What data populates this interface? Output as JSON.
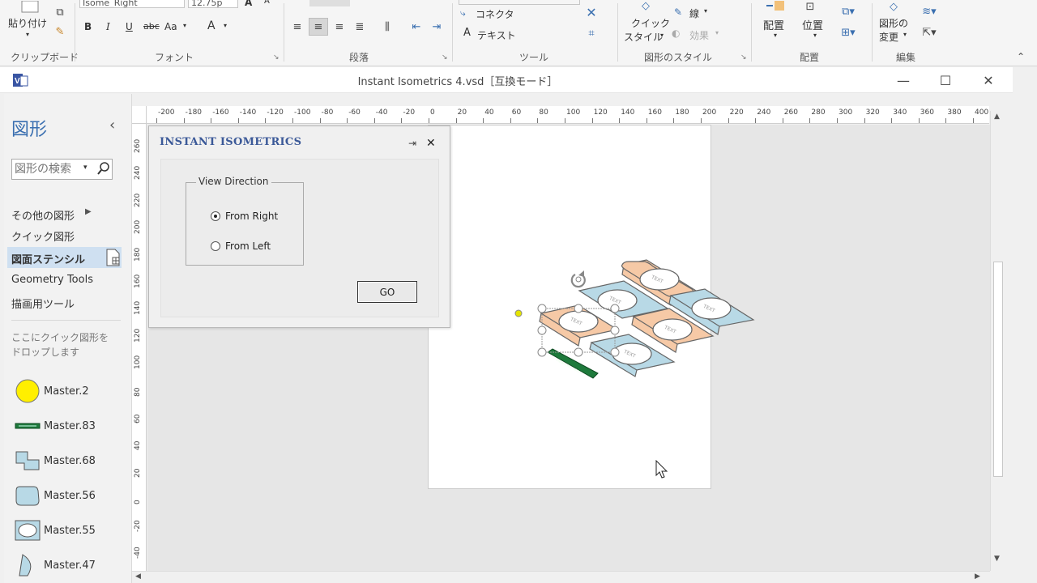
{
  "ribbon": {
    "clipboard": {
      "paste": "貼り付け",
      "group": "クリップボード"
    },
    "font": {
      "name": "Isome_Right",
      "size": "12.75p",
      "bold": "B",
      "italic": "I",
      "underline": "U",
      "strike": "abc",
      "case": "Aa",
      "color": "A",
      "group": "フォント"
    },
    "paragraph": {
      "group": "段落"
    },
    "tools": {
      "connector": "コネクタ",
      "text": "テキスト",
      "group": "ツール"
    },
    "shape_style": {
      "quick": "クイック",
      "style": "スタイル",
      "line": "線",
      "effect": "効果",
      "group": "図形のスタイル"
    },
    "arrange": {
      "align": "配置",
      "position": "位置",
      "group": "配置"
    },
    "edit": {
      "change1": "図形の",
      "change2": "変更",
      "group": "編集"
    }
  },
  "window": {
    "title": "Instant Isometrics 4.vsd［互換モード］",
    "min": "—",
    "max": "☐",
    "close": "✕"
  },
  "shapes_pane": {
    "title": "図形",
    "collapse": "‹",
    "search_placeholder": "図形の検索",
    "more": "その他の図形",
    "quick": "クイック図形",
    "stencil": "図面ステンシル",
    "geometry": "Geometry Tools",
    "drawing": "描画用ツール",
    "hint": "ここにクイック図形をドロップします",
    "masters": [
      "Master.2",
      "Master.83",
      "Master.68",
      "Master.56",
      "Master.55",
      "Master.47"
    ]
  },
  "hruler": [
    "-200",
    "-180",
    "-160",
    "-140",
    "-120",
    "-100",
    "-80",
    "-60",
    "-40",
    "-20",
    "0",
    "20",
    "40",
    "60",
    "80",
    "100",
    "120",
    "140",
    "160",
    "180",
    "200",
    "220",
    "240",
    "260",
    "280",
    "300",
    "320",
    "340",
    "360",
    "380",
    "400"
  ],
  "vruler": [
    "260",
    "240",
    "220",
    "200",
    "180",
    "160",
    "140",
    "120",
    "100",
    "80",
    "60",
    "40",
    "20",
    "0",
    "-20",
    "-40"
  ],
  "dialog": {
    "title": "INSTANT ISOMETRICS",
    "pin": "⇥",
    "close": "✕",
    "group": "View Direction",
    "option_right": "From Right",
    "option_left": "From Left",
    "selected": "From Right",
    "go": "GO"
  },
  "drawing": {
    "tile_label": "TEXT",
    "tag_label": "Instant Isometrics",
    "orange": "#f6c9a6",
    "blue": "#b8d9e6"
  }
}
